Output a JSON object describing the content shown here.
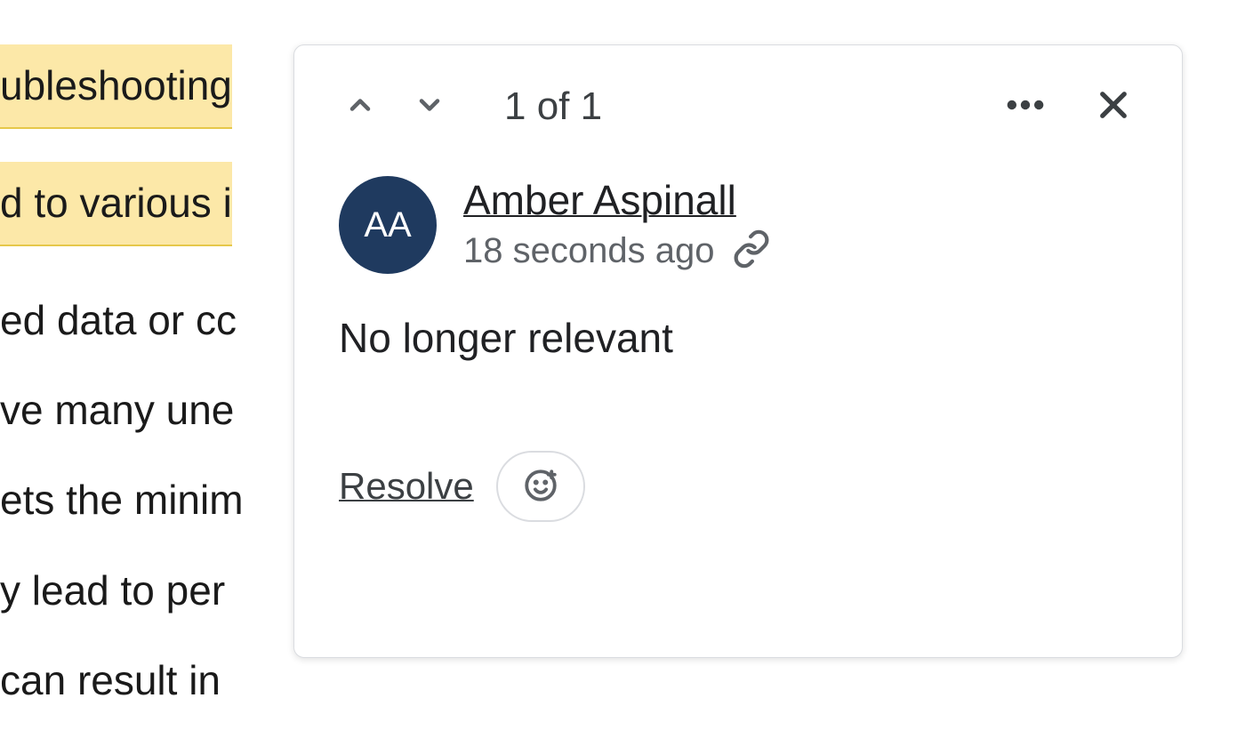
{
  "document": {
    "highlighted_lines": [
      "ubleshooting",
      "d to various i"
    ],
    "plain_lines": [
      "ed data or cc",
      "ve many une",
      "ets the minim",
      "y lead to per",
      "can result in"
    ]
  },
  "comment": {
    "counter": "1 of 1",
    "author_initials": "AA",
    "author_name": "Amber Aspinall",
    "timestamp": "18 seconds ago",
    "body": "No longer relevant",
    "resolve_label": "Resolve"
  }
}
